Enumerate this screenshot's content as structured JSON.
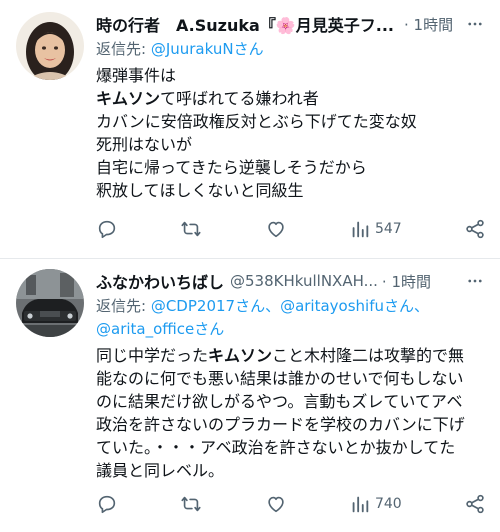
{
  "tweets": [
    {
      "display_name": "時の行者　A.Suzuka『🌸月見英子フ...",
      "handle": "",
      "time": "· 1時間",
      "reply_prefix": "返信先: ",
      "reply_mentions": [
        "@JuurakuNさん"
      ],
      "body_lines": [
        [
          {
            "t": "爆弾事件は"
          }
        ],
        [
          {
            "t": "キムソン",
            "b": true
          },
          {
            "t": "て呼ばれてる嫌われ者"
          }
        ],
        [
          {
            "t": "カバンに安倍政権反対とぶら下げてた変な奴"
          }
        ],
        [
          {
            "t": "死刑はないが"
          }
        ],
        [
          {
            "t": "自宅に帰ってきたら逆襲しそうだから"
          }
        ],
        [
          {
            "t": "釈放してほしくないと同級生"
          }
        ]
      ],
      "views": "547"
    },
    {
      "display_name": "ふなかわいちばし",
      "handle": "@538KHkullNXAH...",
      "time": "· 1時間",
      "reply_prefix": "返信先: ",
      "reply_mentions": [
        "@CDP2017さん、",
        "@aritayoshifuさん、",
        "@arita_officeさん"
      ],
      "body_lines": [
        [
          {
            "t": "同じ中学だった"
          },
          {
            "t": "キムソン",
            "b": true
          },
          {
            "t": "こと木村隆二は攻撃的で無"
          }
        ],
        [
          {
            "t": "能なのに何でも悪い結果は誰かのせいで何もしない"
          }
        ],
        [
          {
            "t": "のに結果だけ欲しがるやつ。言動もズレていてアベ"
          }
        ],
        [
          {
            "t": "政治を許さないのプラカードを学校のカバンに下げ"
          }
        ],
        [
          {
            "t": "ていた。・・・アベ政治を許さないとか抜かしてた"
          }
        ],
        [
          {
            "t": "議員と同レベル。"
          }
        ]
      ],
      "views": "740"
    }
  ],
  "icons": [
    "more-icon",
    "reply-icon",
    "retweet-icon",
    "like-icon",
    "views-icon",
    "share-icon"
  ],
  "colors": {
    "secondary": "#536471",
    "link": "#1d9bf0",
    "text": "#0f1419",
    "divider": "#e6e9ec"
  }
}
